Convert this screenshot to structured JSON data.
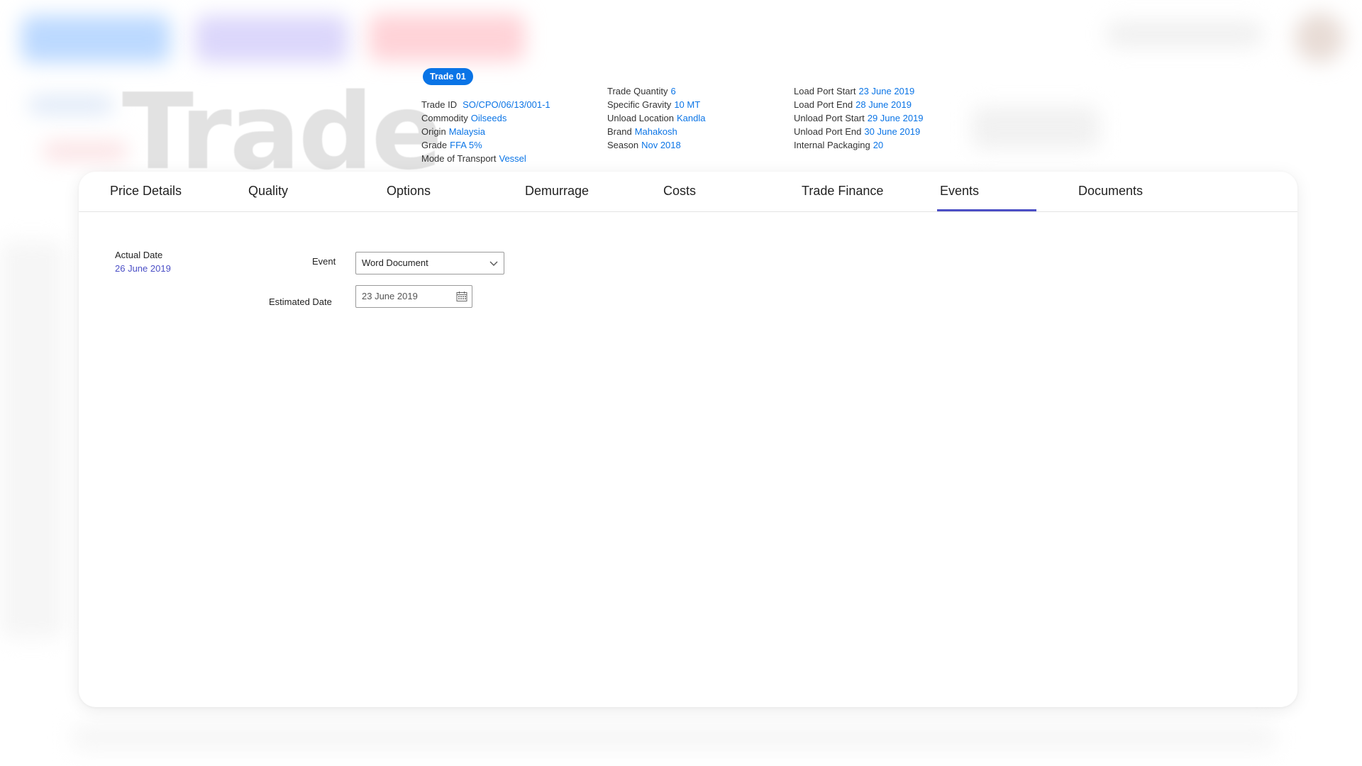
{
  "background": {
    "title": "Trade"
  },
  "summary": {
    "badge": "Trade 01",
    "column1": [
      {
        "label": "Trade ID",
        "value": "SO/CPO/06/13/001-1"
      },
      {
        "label": "Commodity",
        "value": "Oilseeds"
      },
      {
        "label": "Origin",
        "value": "Malaysia"
      },
      {
        "label": "Grade",
        "value": "FFA 5%"
      },
      {
        "label": "Mode of Transport",
        "value": "Vessel"
      }
    ],
    "column2": [
      {
        "label": "Trade Quantity",
        "value": "6"
      },
      {
        "label": "Specific Gravity",
        "value": "10 MT"
      },
      {
        "label": "Unload Location",
        "value": "Kandla"
      },
      {
        "label": "Brand",
        "value": "Mahakosh"
      },
      {
        "label": "Season",
        "value": "Nov 2018"
      }
    ],
    "column3": [
      {
        "label": "Load Port Start",
        "value": "23 June 2019"
      },
      {
        "label": "Load Port End",
        "value": "28 June 2019"
      },
      {
        "label": "Unload Port Start",
        "value": "29 June 2019"
      },
      {
        "label": "Unload Port End",
        "value": "30 June 2019"
      },
      {
        "label": "Internal Packaging",
        "value": "20"
      }
    ]
  },
  "tabs": [
    {
      "label": "Price Details",
      "active": false
    },
    {
      "label": "Quality",
      "active": false
    },
    {
      "label": "Options",
      "active": false
    },
    {
      "label": "Demurrage",
      "active": false
    },
    {
      "label": "Costs",
      "active": false
    },
    {
      "label": "Trade Finance",
      "active": false
    },
    {
      "label": "Events",
      "active": true
    },
    {
      "label": "Documents",
      "active": false
    }
  ],
  "events_form": {
    "actual_date_label": "Actual Date",
    "actual_date_value": "26 June 2019",
    "event_label": "Event",
    "event_value": "Word Document",
    "estimated_date_label": "Estimated Date",
    "estimated_date_value": "23 June 2019"
  },
  "colors": {
    "accent": "#0a74e6",
    "active_tab": "#4b4fc6",
    "badge_bg": "#0a74e6"
  },
  "icons": {
    "dropdown": "chevron-down-icon",
    "date": "calendar-icon"
  }
}
